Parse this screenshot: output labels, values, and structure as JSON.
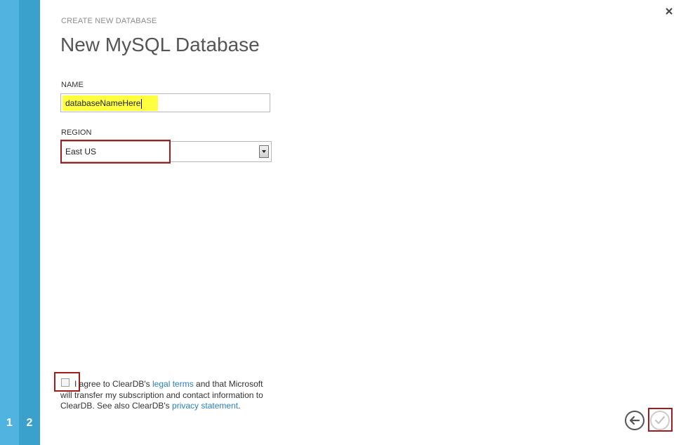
{
  "wizard": {
    "steps": [
      "1",
      "2"
    ],
    "subheading": "CREATE NEW DATABASE",
    "title": "New MySQL Database"
  },
  "form": {
    "name_label": "NAME",
    "name_value": "databaseNameHere",
    "region_label": "REGION",
    "region_value": "East US"
  },
  "agreement": {
    "text_1": "I agree to ClearDB's ",
    "legal_link": "legal terms",
    "text_2": " and that Microsoft will transfer my subscription and contact information to ClearDB. See also ClearDB's ",
    "privacy_link": "privacy statement",
    "text_3": "."
  },
  "icons": {
    "close": "close-icon",
    "back": "back-arrow-icon",
    "finish": "checkmark-icon"
  },
  "colors": {
    "step_rail_light": "#50b3e0",
    "step_rail_dark": "#3aa0cc",
    "highlight": "#ffff40",
    "annotation_border": "#a31b1b",
    "link": "#2a7fbf"
  }
}
